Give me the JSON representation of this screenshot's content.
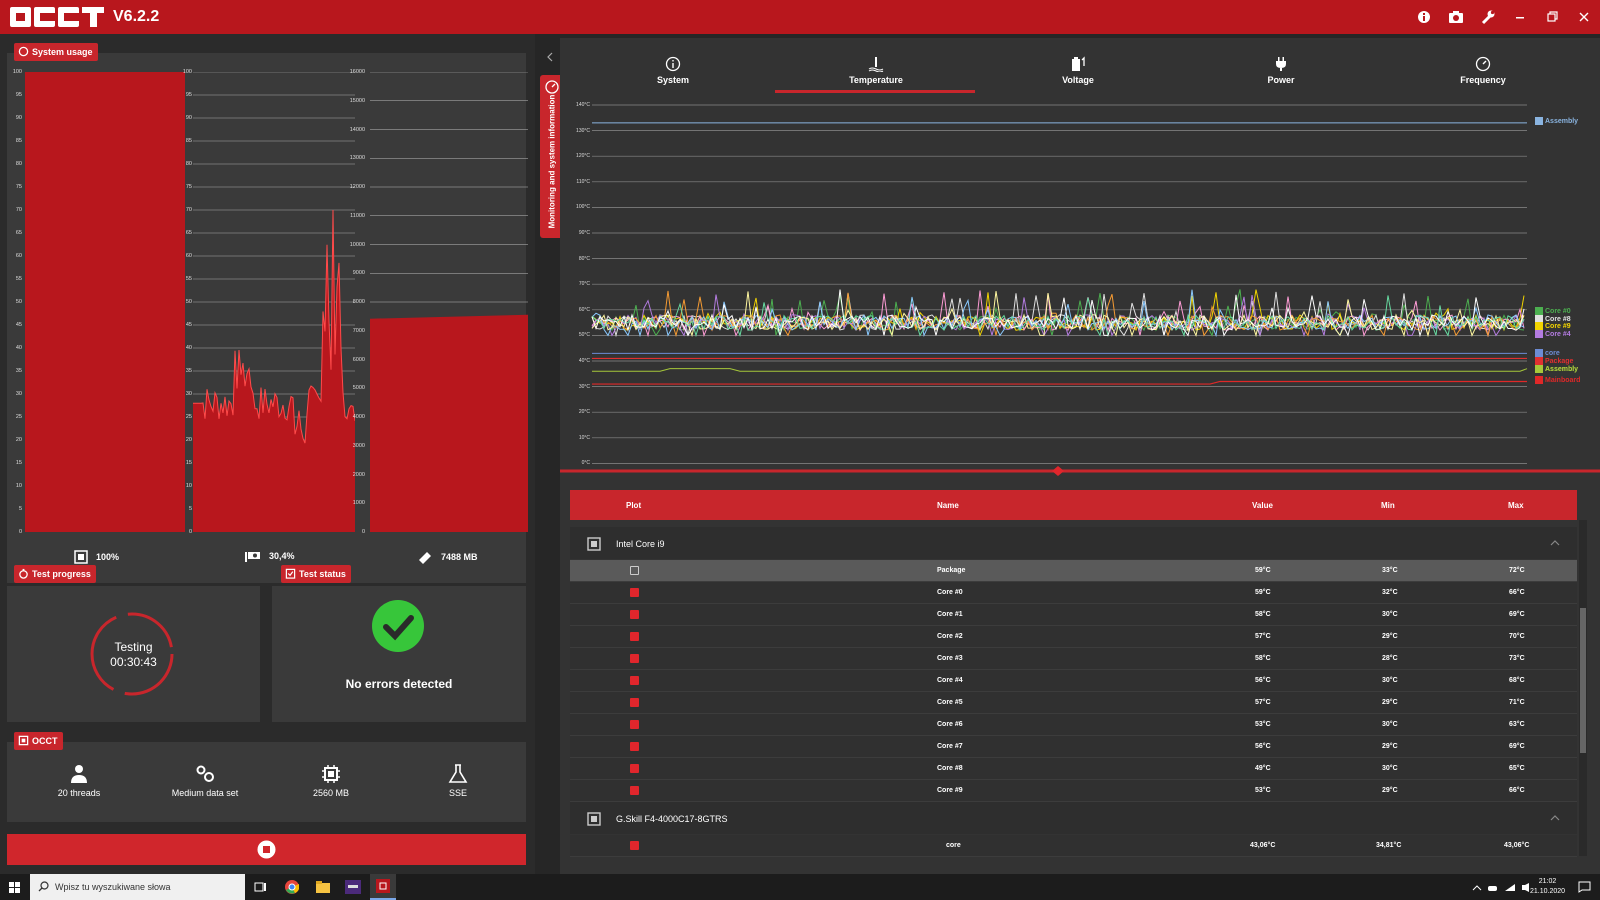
{
  "app": {
    "version": "V6.2.2"
  },
  "system_usage": {
    "label": "System usage",
    "cpu": {
      "ticks": [
        "100",
        "95",
        "90",
        "85",
        "80",
        "75",
        "70",
        "65",
        "60",
        "55",
        "50",
        "45",
        "40",
        "35",
        "30",
        "25",
        "20",
        "15",
        "10",
        "5",
        "0"
      ],
      "summary": "100%",
      "value": 100
    },
    "gpu": {
      "ticks": [
        "100",
        "95",
        "90",
        "85",
        "80",
        "75",
        "70",
        "65",
        "60",
        "55",
        "50",
        "45",
        "40",
        "35",
        "30",
        "25",
        "20",
        "15",
        "10",
        "5",
        "0"
      ],
      "summary": "30,4%"
    },
    "mem": {
      "ticks": [
        "16000",
        "15000",
        "14000",
        "13000",
        "12000",
        "11000",
        "10000",
        "9000",
        "8000",
        "7000",
        "6000",
        "5000",
        "4000",
        "3000",
        "2000",
        "1000",
        "0"
      ],
      "summary": "7488 MB",
      "value": 7488
    }
  },
  "test_progress": {
    "label": "Test progress",
    "status": "Testing",
    "time": "00:30:43"
  },
  "test_status": {
    "label": "Test status",
    "message": "No errors detected"
  },
  "occt": {
    "label": "OCCT",
    "items": [
      {
        "icon": "worker-icon",
        "label": "20 threads"
      },
      {
        "icon": "gears-icon",
        "label": "Medium data set"
      },
      {
        "icon": "chip-icon",
        "label": "2560 MB"
      },
      {
        "icon": "flask-icon",
        "label": "SSE"
      }
    ]
  },
  "side_tab": {
    "label": "Monitoring and system information"
  },
  "tabs": [
    {
      "label": "System"
    },
    {
      "label": "Temperature"
    },
    {
      "label": "Voltage"
    },
    {
      "label": "Power"
    },
    {
      "label": "Frequency"
    }
  ],
  "temp_chart": {
    "ticks": [
      "140°C",
      "130°C",
      "120°C",
      "110°C",
      "100°C",
      "90°C",
      "80°C",
      "70°C",
      "60°C",
      "50°C",
      "40°C",
      "30°C",
      "20°C",
      "10°C",
      "0°C"
    ],
    "legend": [
      "Assembly",
      "Core #0",
      "Core #8",
      "Core #9",
      "Core #4",
      "core",
      "Assembly",
      "Package",
      "Assembly",
      "Mainboard"
    ]
  },
  "table": {
    "headers": {
      "plot": "Plot",
      "name": "Name",
      "value": "Value",
      "min": "Min",
      "max": "Max"
    },
    "group1": "Intel Core i9",
    "rows": [
      {
        "name": "Package",
        "value": "59°C",
        "min": "33°C",
        "max": "72°C",
        "checked": false
      },
      {
        "name": "Core #0",
        "value": "59°C",
        "min": "32°C",
        "max": "66°C",
        "checked": true
      },
      {
        "name": "Core #1",
        "value": "58°C",
        "min": "30°C",
        "max": "69°C",
        "checked": true
      },
      {
        "name": "Core #2",
        "value": "57°C",
        "min": "29°C",
        "max": "70°C",
        "checked": true
      },
      {
        "name": "Core #3",
        "value": "58°C",
        "min": "28°C",
        "max": "73°C",
        "checked": true
      },
      {
        "name": "Core #4",
        "value": "56°C",
        "min": "30°C",
        "max": "68°C",
        "checked": true
      },
      {
        "name": "Core #5",
        "value": "57°C",
        "min": "29°C",
        "max": "71°C",
        "checked": true
      },
      {
        "name": "Core #6",
        "value": "53°C",
        "min": "30°C",
        "max": "63°C",
        "checked": true
      },
      {
        "name": "Core #7",
        "value": "56°C",
        "min": "29°C",
        "max": "69°C",
        "checked": true
      },
      {
        "name": "Core #8",
        "value": "49°C",
        "min": "30°C",
        "max": "65°C",
        "checked": true
      },
      {
        "name": "Core #9",
        "value": "53°C",
        "min": "29°C",
        "max": "66°C",
        "checked": true
      }
    ],
    "group2": "G.Skill F4-4000C17-8GTRS",
    "row2": {
      "name": "core",
      "value": "43,06°C",
      "min": "34,81°C",
      "max": "43,06°C"
    }
  },
  "taskbar": {
    "search_placeholder": "Wpisz tu wyszukiwane słowa",
    "time": "21:02",
    "date": "21.10.2020"
  }
}
